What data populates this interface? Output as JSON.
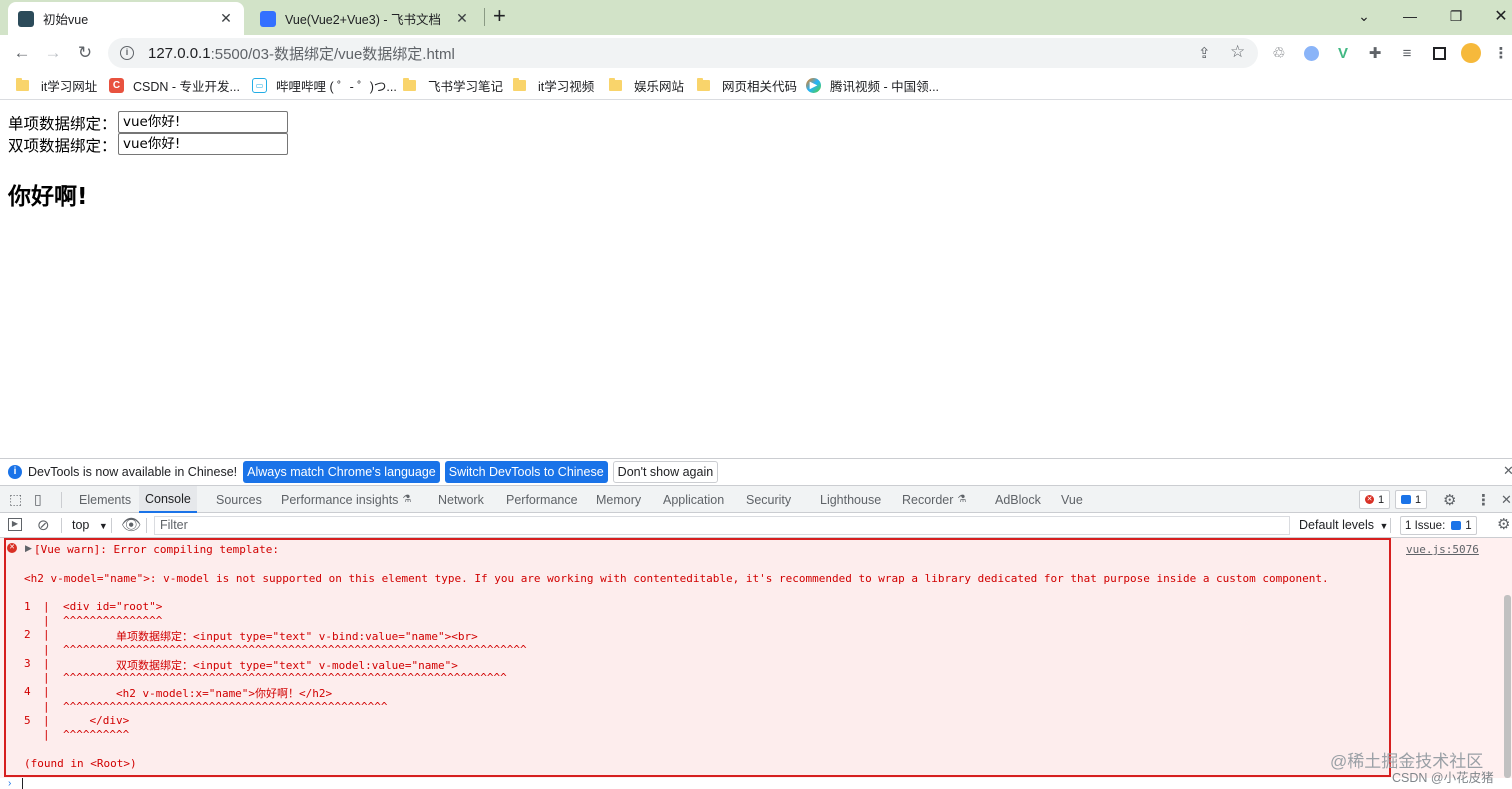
{
  "tabs": [
    {
      "title": "初始vue",
      "active": true
    },
    {
      "title": "Vue(Vue2+Vue3) - 飞书文档",
      "active": false
    }
  ],
  "toolbar": {
    "url_host": "127.0.0.1",
    "url_path": ":5500/03-数据绑定/vue数据绑定.html"
  },
  "bookmarks": [
    {
      "label": "it学习网址",
      "icon": "folder-icon"
    },
    {
      "label": "CSDN - 专业开发...",
      "icon": "csdn-icon"
    },
    {
      "label": "哔哩哔哩 ( ゜- ゜)つ...",
      "icon": "bilibili-icon"
    },
    {
      "label": "飞书学习笔记",
      "icon": "folder-icon"
    },
    {
      "label": "it学习视频",
      "icon": "folder-icon"
    },
    {
      "label": "娱乐网站",
      "icon": "folder-icon"
    },
    {
      "label": "网页相关代码",
      "icon": "folder-icon"
    },
    {
      "label": "腾讯视频 - 中国领...",
      "icon": "tencent-video-icon"
    }
  ],
  "page": {
    "single_label": "单项数据绑定：",
    "single_value": "vue你好!",
    "double_label": "双项数据绑定：",
    "double_value": "vue你好!",
    "heading": "你好啊!"
  },
  "devtools": {
    "infobar": {
      "message": "DevTools is now available in Chinese!",
      "btn_match": "Always match Chrome's language",
      "btn_switch": "Switch DevTools to Chinese",
      "btn_dont": "Don't show again"
    },
    "tabs": [
      "Elements",
      "Console",
      "Sources",
      "Performance insights",
      "Network",
      "Performance",
      "Memory",
      "Application",
      "Security",
      "Lighthouse",
      "Recorder",
      "AdBlock",
      "Vue"
    ],
    "error_count": "1",
    "message_count": "1",
    "context": "top",
    "filter_placeholder": "Filter",
    "levels": "Default levels",
    "issues": "1 Issue:",
    "issues_count": "1",
    "error": {
      "head": "[Vue warn]: Error compiling template:",
      "source": "vue.js:5076",
      "detail": "<h2 v-model=\"name\">: v-model is not supported on this element type. If you are working with contenteditable, it's recommended to wrap a library dedicated for that purpose inside a custom component.",
      "lines": [
        {
          "num": "1",
          "code": "<div id=\"root\">",
          "carets": "^^^^^^^^^^^^^^^"
        },
        {
          "num": "2",
          "code": "        单项数据绑定：<input type=\"text\" v-bind:value=\"name\"><br>",
          "carets": "^^^^^^^^^^^^^^^^^^^^^^^^^^^^^^^^^^^^^^^^^^^^^^^^^^^^^^^^^^^^^^^^^^^^^^"
        },
        {
          "num": "3",
          "code": "        双项数据绑定：<input type=\"text\" v-model:value=\"name\">",
          "carets": "^^^^^^^^^^^^^^^^^^^^^^^^^^^^^^^^^^^^^^^^^^^^^^^^^^^^^^^^^^^^^^^^^^^"
        },
        {
          "num": "4",
          "code": "        <h2 v-model:x=\"name\">你好啊！</h2>",
          "carets": "^^^^^^^^^^^^^^^^^^^^^^^^^^^^^^^^^^^^^^^^^^^^^^^^^"
        },
        {
          "num": "5",
          "code": "    </div>",
          "carets": "^^^^^^^^^^"
        }
      ],
      "found": "(found in <Root>)"
    }
  },
  "watermark": {
    "line1": "@稀土掘金技术社区",
    "line2": "CSDN @小花皮猪"
  },
  "colors": {
    "tabstrip": "#d2e3c8",
    "accent": "#1a73e8",
    "error_text": "#d10000",
    "error_border": "#d61f1f",
    "error_bg": "#fdeded"
  }
}
